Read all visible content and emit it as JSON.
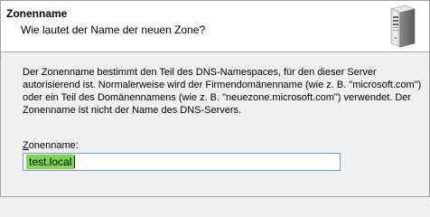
{
  "header": {
    "title": "Zonenname",
    "subtitle": "Wie lautet der Name der neuen Zone?",
    "icon": "server-icon"
  },
  "description": {
    "lines": [
      "Der Zonenname bestimmt den Teil des DNS-Namespaces, für den dieser Server",
      "autorisierend ist. Normalerweise wird der Firmendomänenname (wie z. B. \"microsoft.com\")",
      "oder ein Teil des Domänennamens (wie z. B. \"neuezone.microsoft.com\") verwendet. Der",
      "Zonenname ist nicht der Name des DNS-Servers."
    ]
  },
  "zone_field": {
    "label_accel": "Z",
    "label_rest": "onenname:",
    "value": "test.local"
  },
  "colors": {
    "input_highlight": "#7dd84a",
    "input_border": "#7a9cc8",
    "window_bg": "#f0f0f0"
  }
}
